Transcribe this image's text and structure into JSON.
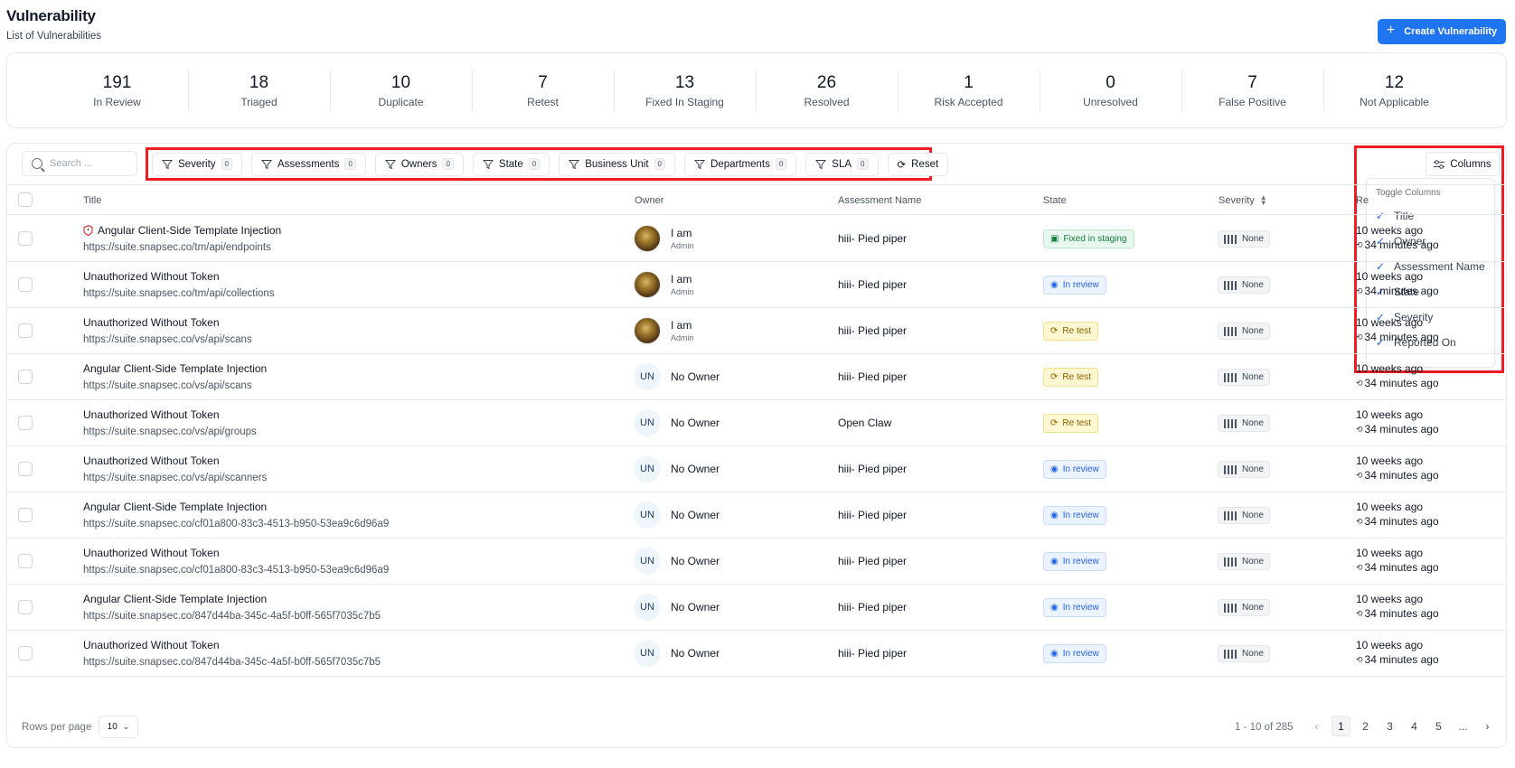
{
  "header": {
    "title": "Vulnerability",
    "subtitle": "List of Vulnerabilities",
    "create_label": "Create Vulnerability",
    "accent": "#1f74f0"
  },
  "stats": [
    {
      "value": "191",
      "label": "In Review"
    },
    {
      "value": "18",
      "label": "Triaged"
    },
    {
      "value": "10",
      "label": "Duplicate"
    },
    {
      "value": "7",
      "label": "Retest"
    },
    {
      "value": "13",
      "label": "Fixed In Staging"
    },
    {
      "value": "26",
      "label": "Resolved"
    },
    {
      "value": "1",
      "label": "Risk Accepted"
    },
    {
      "value": "0",
      "label": "Unresolved"
    },
    {
      "value": "7",
      "label": "False Positive"
    },
    {
      "value": "12",
      "label": "Not Applicable"
    }
  ],
  "search": {
    "placeholder": "Search ..."
  },
  "filters": [
    {
      "label": "Severity",
      "count": "0"
    },
    {
      "label": "Assessments",
      "count": "0"
    },
    {
      "label": "Owners",
      "count": "0"
    },
    {
      "label": "State",
      "count": "0"
    },
    {
      "label": "Business Unit",
      "count": "0"
    },
    {
      "label": "Departments",
      "count": "0"
    },
    {
      "label": "SLA",
      "count": "0"
    }
  ],
  "reset_label": "Reset",
  "columns_button": "Columns",
  "columns_menu": {
    "title": "Toggle Columns",
    "items": [
      "Title",
      "Owner",
      "Assessment Name",
      "State",
      "Severity",
      "Reported On"
    ]
  },
  "table": {
    "headers": {
      "title": "Title",
      "owner": "Owner",
      "assessment": "Assessment Name",
      "state": "State",
      "severity": "Severity",
      "reported": "Re"
    },
    "rows": [
      {
        "title": "Angular Client-Side Template Injection",
        "url": "https://suite.snapsec.co/tm/api/endpoints",
        "owner": "I am",
        "role": "Admin",
        "avatar": "img",
        "assessment": "hiii- Pied piper",
        "state": "Fixed in staging",
        "state_color": "green",
        "severity": "None",
        "reported": "10 weeks ago",
        "updated": "34 minutes ago",
        "flag": true
      },
      {
        "title": "Unauthorized Without Token",
        "url": "https://suite.snapsec.co/tm/api/collections",
        "owner": "I am",
        "role": "Admin",
        "avatar": "img",
        "assessment": "hiii- Pied piper",
        "state": "In review",
        "state_color": "blue",
        "severity": "None",
        "reported": "10 weeks ago",
        "updated": "34 minutes ago",
        "flag": false
      },
      {
        "title": "Unauthorized Without Token",
        "url": "https://suite.snapsec.co/vs/api/scans",
        "owner": "I am",
        "role": "Admin",
        "avatar": "img",
        "assessment": "hiii- Pied piper",
        "state": "Re test",
        "state_color": "yellow",
        "severity": "None",
        "reported": "10 weeks ago",
        "updated": "34 minutes ago",
        "flag": false
      },
      {
        "title": "Angular Client-Side Template Injection",
        "url": "https://suite.snapsec.co/vs/api/scans",
        "owner": "No Owner",
        "role": "",
        "avatar": "UN",
        "assessment": "hiii- Pied piper",
        "state": "Re test",
        "state_color": "yellow",
        "severity": "None",
        "reported": "10 weeks ago",
        "updated": "34 minutes ago",
        "flag": false
      },
      {
        "title": "Unauthorized Without Token",
        "url": "https://suite.snapsec.co/vs/api/groups",
        "owner": "No Owner",
        "role": "",
        "avatar": "UN",
        "assessment": "Open Claw",
        "state": "Re test",
        "state_color": "yellow",
        "severity": "None",
        "reported": "10 weeks ago",
        "updated": "34 minutes ago",
        "flag": false
      },
      {
        "title": "Unauthorized Without Token",
        "url": "https://suite.snapsec.co/vs/api/scanners",
        "owner": "No Owner",
        "role": "",
        "avatar": "UN",
        "assessment": "hiii- Pied piper",
        "state": "In review",
        "state_color": "blue",
        "severity": "None",
        "reported": "10 weeks ago",
        "updated": "34 minutes ago",
        "flag": false
      },
      {
        "title": "Angular Client-Side Template Injection",
        "url": "https://suite.snapsec.co/cf01a800-83c3-4513-b950-53ea9c6d96a9",
        "owner": "No Owner",
        "role": "",
        "avatar": "UN",
        "assessment": "hiii- Pied piper",
        "state": "In review",
        "state_color": "blue",
        "severity": "None",
        "reported": "10 weeks ago",
        "updated": "34 minutes ago",
        "flag": false
      },
      {
        "title": "Unauthorized Without Token",
        "url": "https://suite.snapsec.co/cf01a800-83c3-4513-b950-53ea9c6d96a9",
        "owner": "No Owner",
        "role": "",
        "avatar": "UN",
        "assessment": "hiii- Pied piper",
        "state": "In review",
        "state_color": "blue",
        "severity": "None",
        "reported": "10 weeks ago",
        "updated": "34 minutes ago",
        "flag": false
      },
      {
        "title": "Angular Client-Side Template Injection",
        "url": "https://suite.snapsec.co/847d44ba-345c-4a5f-b0ff-565f7035c7b5",
        "owner": "No Owner",
        "role": "",
        "avatar": "UN",
        "assessment": "hiii- Pied piper",
        "state": "In review",
        "state_color": "blue",
        "severity": "None",
        "reported": "10 weeks ago",
        "updated": "34 minutes ago",
        "flag": false
      },
      {
        "title": "Unauthorized Without Token",
        "url": "https://suite.snapsec.co/847d44ba-345c-4a5f-b0ff-565f7035c7b5",
        "owner": "No Owner",
        "role": "",
        "avatar": "UN",
        "assessment": "hiii- Pied piper",
        "state": "In review",
        "state_color": "blue",
        "severity": "None",
        "reported": "10 weeks ago",
        "updated": "34 minutes ago",
        "flag": false
      }
    ]
  },
  "footer": {
    "rows_per_page_label": "Rows per page",
    "rows_per_page_value": "10",
    "range": "1 - 10 of 285",
    "pages": [
      "1",
      "2",
      "3",
      "4",
      "5",
      "..."
    ],
    "current_page": "1"
  }
}
